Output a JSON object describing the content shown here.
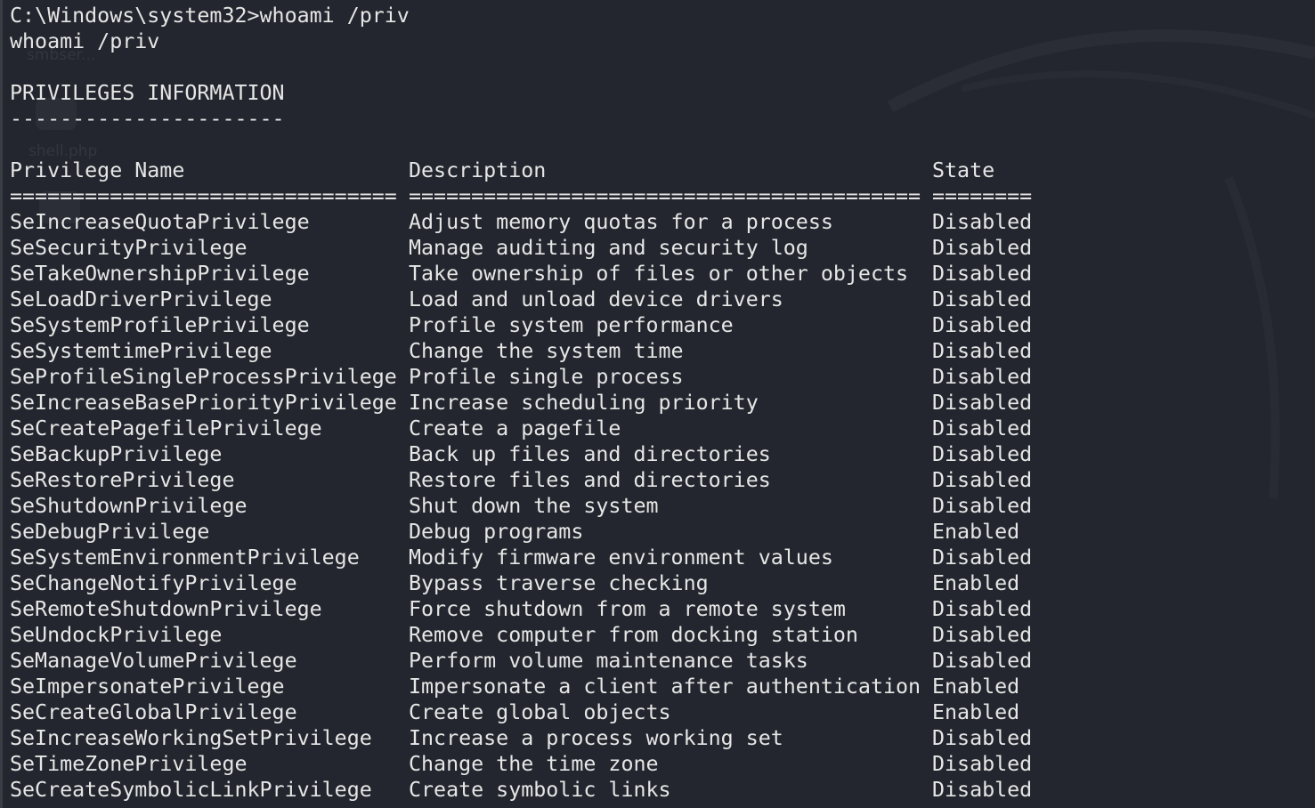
{
  "terminal": {
    "prompt_line": "C:\\Windows\\system32>whoami /priv",
    "echo_line": "whoami /priv",
    "section_title": "PRIVILEGES INFORMATION",
    "section_underline": "----------------------",
    "headers": {
      "name": "Privilege Name",
      "description": "Description",
      "state": "State"
    },
    "separators": {
      "name": "===============================",
      "description": "=========================================",
      "state": "========"
    },
    "rows": [
      {
        "name": "SeIncreaseQuotaPrivilege",
        "description": "Adjust memory quotas for a process",
        "state": "Disabled"
      },
      {
        "name": "SeSecurityPrivilege",
        "description": "Manage auditing and security log",
        "state": "Disabled"
      },
      {
        "name": "SeTakeOwnershipPrivilege",
        "description": "Take ownership of files or other objects",
        "state": "Disabled"
      },
      {
        "name": "SeLoadDriverPrivilege",
        "description": "Load and unload device drivers",
        "state": "Disabled"
      },
      {
        "name": "SeSystemProfilePrivilege",
        "description": "Profile system performance",
        "state": "Disabled"
      },
      {
        "name": "SeSystemtimePrivilege",
        "description": "Change the system time",
        "state": "Disabled"
      },
      {
        "name": "SeProfileSingleProcessPrivilege",
        "description": "Profile single process",
        "state": "Disabled"
      },
      {
        "name": "SeIncreaseBasePriorityPrivilege",
        "description": "Increase scheduling priority",
        "state": "Disabled"
      },
      {
        "name": "SeCreatePagefilePrivilege",
        "description": "Create a pagefile",
        "state": "Disabled"
      },
      {
        "name": "SeBackupPrivilege",
        "description": "Back up files and directories",
        "state": "Disabled"
      },
      {
        "name": "SeRestorePrivilege",
        "description": "Restore files and directories",
        "state": "Disabled"
      },
      {
        "name": "SeShutdownPrivilege",
        "description": "Shut down the system",
        "state": "Disabled"
      },
      {
        "name": "SeDebugPrivilege",
        "description": "Debug programs",
        "state": "Enabled"
      },
      {
        "name": "SeSystemEnvironmentPrivilege",
        "description": "Modify firmware environment values",
        "state": "Disabled"
      },
      {
        "name": "SeChangeNotifyPrivilege",
        "description": "Bypass traverse checking",
        "state": "Enabled"
      },
      {
        "name": "SeRemoteShutdownPrivilege",
        "description": "Force shutdown from a remote system",
        "state": "Disabled"
      },
      {
        "name": "SeUndockPrivilege",
        "description": "Remove computer from docking station",
        "state": "Disabled"
      },
      {
        "name": "SeManageVolumePrivilege",
        "description": "Perform volume maintenance tasks",
        "state": "Disabled"
      },
      {
        "name": "SeImpersonatePrivilege",
        "description": "Impersonate a client after authentication",
        "state": "Enabled"
      },
      {
        "name": "SeCreateGlobalPrivilege",
        "description": "Create global objects",
        "state": "Enabled"
      },
      {
        "name": "SeIncreaseWorkingSetPrivilege",
        "description": "Increase a process working set",
        "state": "Disabled"
      },
      {
        "name": "SeTimeZonePrivilege",
        "description": "Change the time zone",
        "state": "Disabled"
      },
      {
        "name": "SeCreateSymbolicLinkPrivilege",
        "description": "Create symbolic links",
        "state": "Disabled"
      }
    ]
  },
  "desktop_ghost": {
    "label_1": "smbser...",
    "label_2": "shell.php"
  },
  "colors": {
    "background": "#23262e",
    "text": "#e6e6e6"
  }
}
